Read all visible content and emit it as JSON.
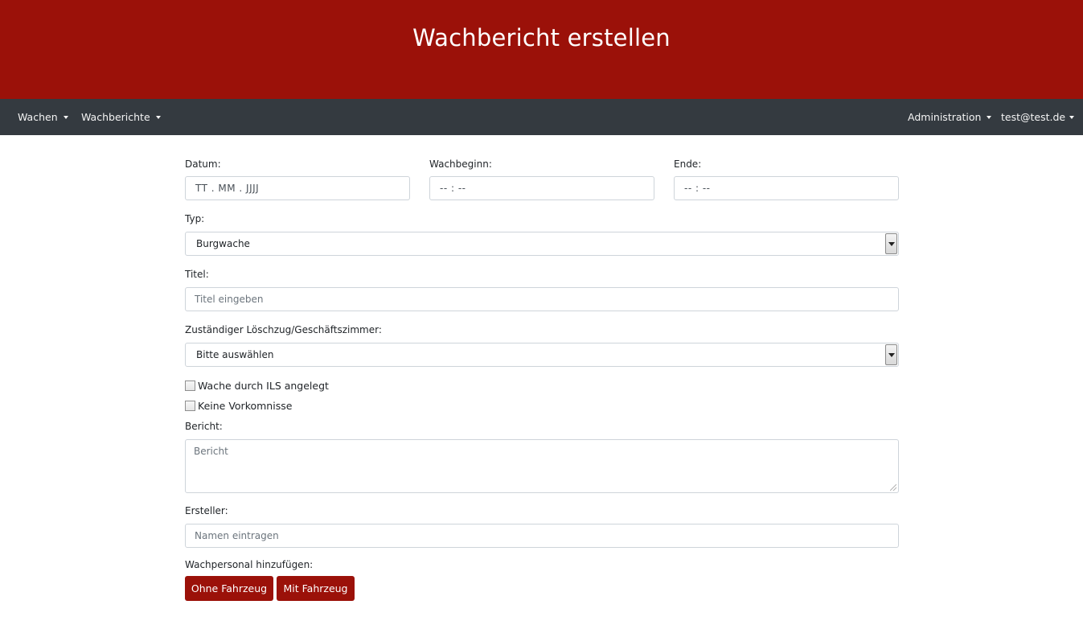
{
  "header": {
    "title": "Wachbericht erstellen"
  },
  "navbar": {
    "left": [
      {
        "label": "Wachen"
      },
      {
        "label": "Wachberichte"
      }
    ],
    "right": [
      {
        "label": "Administration"
      },
      {
        "label": "test@test.de"
      }
    ]
  },
  "form": {
    "date": {
      "label": "Datum:",
      "value": "TT . MM . JJJJ"
    },
    "start": {
      "label": "Wachbeginn:",
      "value": "-- : --"
    },
    "end": {
      "label": "Ende:",
      "value": "-- : --"
    },
    "type": {
      "label": "Typ:",
      "selected": "Burgwache"
    },
    "title": {
      "label": "Titel:",
      "placeholder": "Titel eingeben",
      "value": ""
    },
    "unit": {
      "label": "Zuständiger Löschzug/Geschäftszimmer:",
      "selected": "Bitte auswählen"
    },
    "checkboxes": [
      {
        "label": "Wache durch ILS angelegt",
        "checked": false
      },
      {
        "label": "Keine Vorkomnisse",
        "checked": false
      }
    ],
    "report": {
      "label": "Bericht:",
      "placeholder": "Bericht",
      "value": ""
    },
    "author": {
      "label": "Ersteller:",
      "placeholder": "Namen eintragen",
      "value": ""
    },
    "personnel": {
      "label": "Wachpersonal hinzufügen:",
      "buttons": [
        {
          "label": "Ohne Fahrzeug"
        },
        {
          "label": "Mit Fahrzeug"
        }
      ]
    }
  },
  "colors": {
    "brand": "#9b1109",
    "navbar": "#343a40",
    "border": "#ced4da"
  }
}
